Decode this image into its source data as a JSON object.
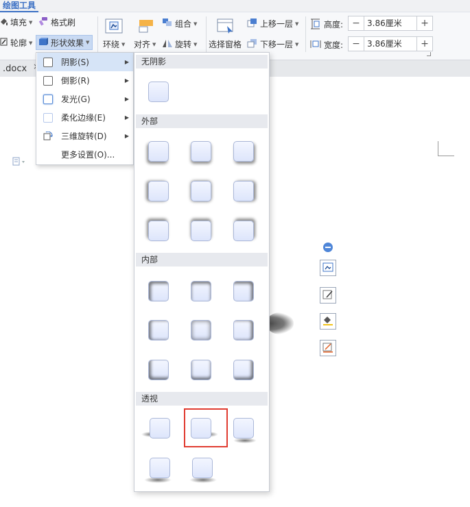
{
  "ribbon": {
    "tool_tab": "绘图工具",
    "fill": "填充",
    "format_painter": "格式刷",
    "outline": "轮廓",
    "shape_effects": "形状效果",
    "wrap": "环绕",
    "align": "对齐",
    "group": "组合",
    "rotate": "旋转",
    "selection_pane": "选择窗格",
    "bring_forward": "上移一层",
    "send_backward": "下移一层",
    "height_label": "高度:",
    "width_label": "宽度:",
    "height_value": "3.86厘米",
    "width_value": "3.86厘米"
  },
  "doc_tab": ".docx",
  "shape_effects_menu": [
    {
      "label": "阴影(S)",
      "has_submenu": true,
      "highlighted": true
    },
    {
      "label": "倒影(R)",
      "has_submenu": true
    },
    {
      "label": "发光(G)",
      "has_submenu": true
    },
    {
      "label": "柔化边缘(E)",
      "has_submenu": true
    },
    {
      "label": "三维旋转(D)",
      "has_submenu": true
    },
    {
      "label": "更多设置(O)...",
      "has_submenu": false
    }
  ],
  "shadow_gallery": {
    "sections": [
      "无阴影",
      "外部",
      "内部",
      "透视"
    ],
    "selected_preset": "透视-2"
  },
  "colors": {
    "accent": "#3a6fc4",
    "highlight": "#d6e4f7",
    "selection": "#e03a2f"
  }
}
